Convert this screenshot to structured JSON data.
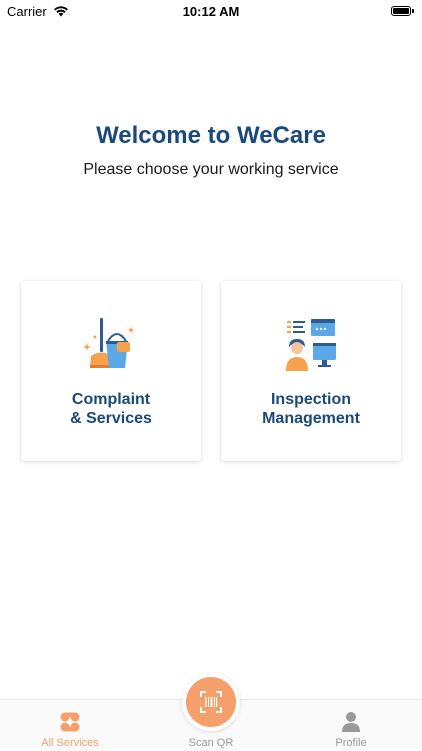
{
  "status_bar": {
    "carrier": "Carrier",
    "time": "10:12 AM"
  },
  "header": {
    "title": "Welcome to WeCare",
    "subtitle": "Please choose your working service"
  },
  "services": [
    {
      "label": "Complaint\n& Services",
      "icon": "cleaning-icon"
    },
    {
      "label": "Inspection\nManagement",
      "icon": "inspection-icon"
    }
  ],
  "tabbar": {
    "items": [
      {
        "label": "All Services",
        "icon": "grid-icon",
        "active": true
      },
      {
        "label": "Scan QR",
        "icon": "barcode-icon",
        "active": false
      },
      {
        "label": "Profile",
        "icon": "user-icon",
        "active": false
      }
    ]
  },
  "colors": {
    "brand_blue": "#1b4a7a",
    "accent_orange": "#f5a06a",
    "inactive_gray": "#9a9a9a"
  }
}
